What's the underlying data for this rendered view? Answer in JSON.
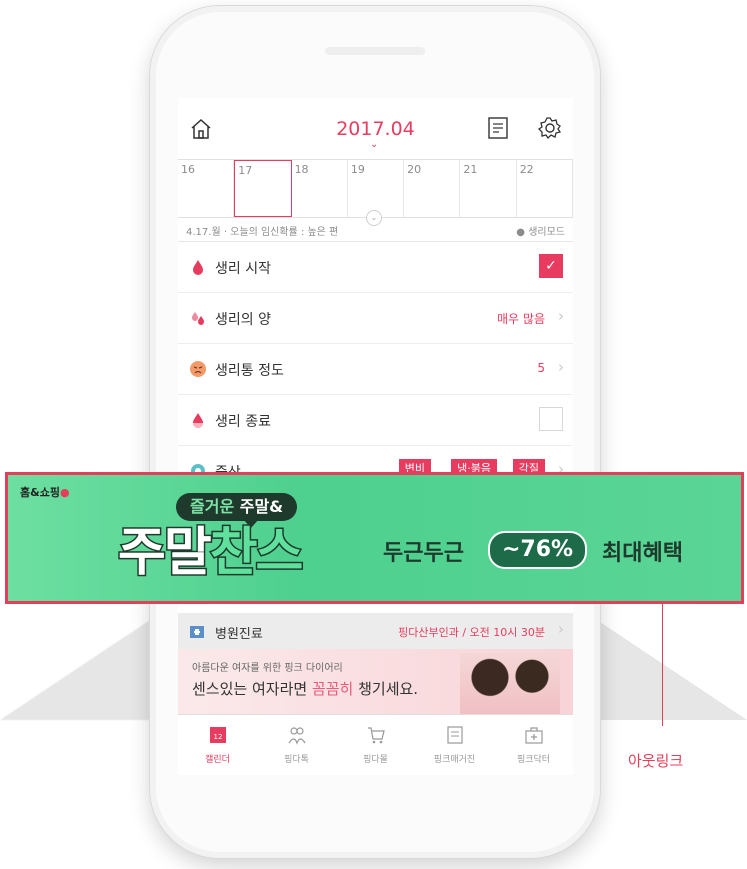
{
  "header": {
    "month": "2017.04"
  },
  "calendar": {
    "days": [
      "16",
      "17",
      "18",
      "19",
      "20",
      "21",
      "22"
    ],
    "status_left": "4.17.월 · 오늘의 임신확률 : 높은 편",
    "status_right": "생리모드"
  },
  "rows": [
    {
      "label": "생리 시작",
      "value": ""
    },
    {
      "label": "생리의 양",
      "value": "매우 많음"
    },
    {
      "label": "생리통 정도",
      "value": "5"
    },
    {
      "label": "생리 종료",
      "value": ""
    },
    {
      "label": "증상",
      "tags": [
        "변비",
        "냉·붉음",
        "각질"
      ]
    }
  ],
  "hospital": {
    "label": "병원진료",
    "value": "핑다산부인과 / 오전 10시 30분"
  },
  "promo": {
    "sub": "아름다운 여자를 위한 핑크 다이어리",
    "main_pre": "센스있는 여자라면 ",
    "main_em": "꼼꼼히",
    "main_post": " 챙기세요."
  },
  "nav": [
    {
      "label": "캘린더",
      "badge": "12",
      "active": true
    },
    {
      "label": "핑다톡"
    },
    {
      "label": "핑다몰"
    },
    {
      "label": "핑크매거진"
    },
    {
      "label": "핑크닥터"
    }
  ],
  "banner": {
    "logo": "홈&쇼핑",
    "bubble_a": "즐거운 ",
    "bubble_b": "주말&",
    "title_a": "주말",
    "title_b": "찬스",
    "sub": "두근두근",
    "pill": "~76%",
    "sub2": "최대혜택"
  },
  "callout": "아웃링크",
  "colors": {
    "accent": "#e73c5f",
    "banner": "#5ad596",
    "banner_dark": "#1e3a2c"
  }
}
